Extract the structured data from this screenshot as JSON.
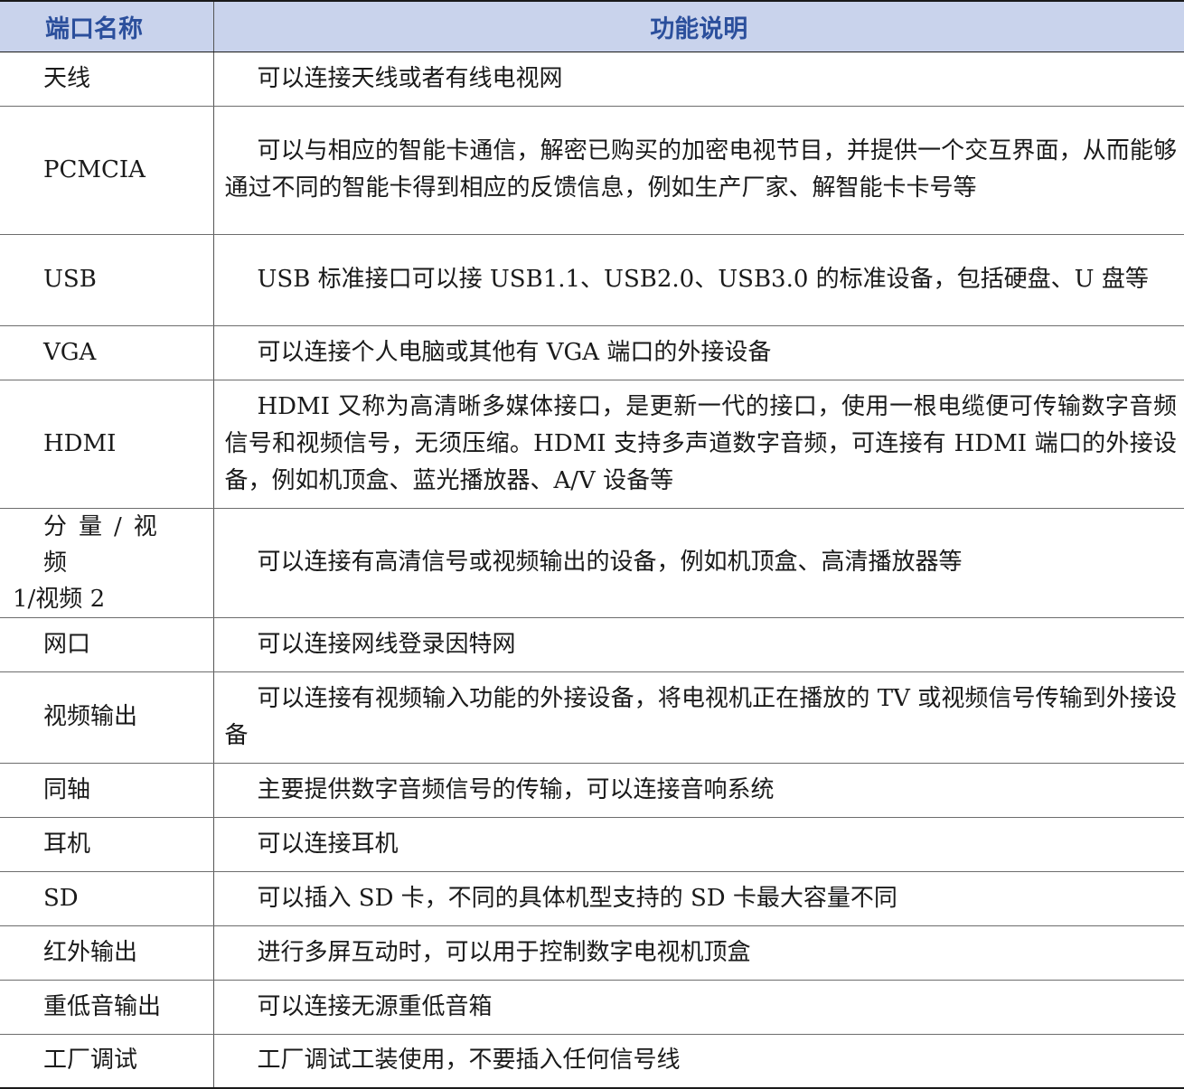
{
  "table": {
    "headers": {
      "name": "端口名称",
      "description": "功能说明"
    },
    "rows": [
      {
        "name": "天线",
        "description": "可以连接天线或者有线电视网"
      },
      {
        "name": "PCMCIA",
        "description": "可以与相应的智能卡通信，解密已购买的加密电视节目，并提供一个交互界面，从而能够通过不同的智能卡得到相应的反馈信息，例如生产厂家、解智能卡卡号等"
      },
      {
        "name": "USB",
        "description": "USB 标准接口可以接 USB1.1、USB2.0、USB3.0 的标准设备，包括硬盘、U 盘等"
      },
      {
        "name": "VGA",
        "description": "可以连接个人电脑或其他有 VGA 端口的外接设备"
      },
      {
        "name": "HDMI",
        "description": "HDMI 又称为高清晰多媒体接口，是更新一代的接口，使用一根电缆便可传输数字音频信号和视频信号，无须压缩。HDMI 支持多声道数字音频，可连接有 HDMI 端口的外接设备，例如机顶盒、蓝光播放器、A/V 设备等"
      },
      {
        "name_line1": "分量/视频",
        "name_line2": "1/视频 2",
        "description": "可以连接有高清信号或视频输出的设备，例如机顶盒、高清播放器等"
      },
      {
        "name": "网口",
        "description": "可以连接网线登录因特网"
      },
      {
        "name": "视频输出",
        "description": "可以连接有视频输入功能的外接设备，将电视机正在播放的 TV 或视频信号传输到外接设备"
      },
      {
        "name": "同轴",
        "description": "主要提供数字音频信号的传输，可以连接音响系统"
      },
      {
        "name": "耳机",
        "description": "可以连接耳机"
      },
      {
        "name": "SD",
        "description": "可以插入 SD 卡，不同的具体机型支持的 SD 卡最大容量不同"
      },
      {
        "name": "红外输出",
        "description": "进行多屏互动时，可以用于控制数字电视机顶盒"
      },
      {
        "name": "重低音输出",
        "description": "可以连接无源重低音箱"
      },
      {
        "name": "工厂调试",
        "description": "工厂调试工装使用，不要插入任何信号线"
      }
    ]
  },
  "colors": {
    "header_background": "#c9d3ec",
    "header_text": "#2b4f9c",
    "body_text": "#1a1a1a"
  }
}
